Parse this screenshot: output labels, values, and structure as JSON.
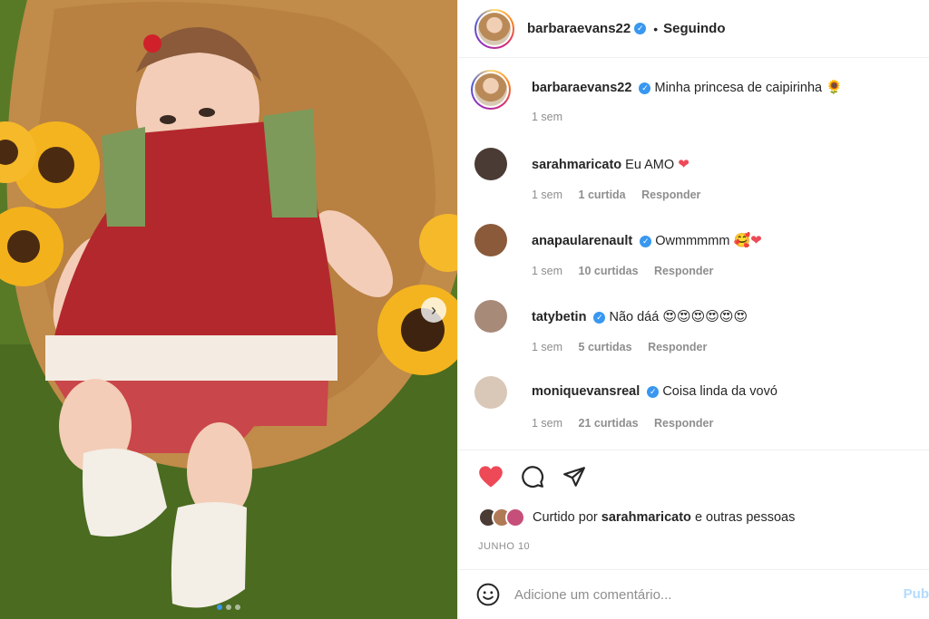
{
  "post": {
    "username": "barbaraevans22",
    "verified_mark": "✓",
    "separator": "•",
    "follow_label": "Seguindo"
  },
  "caption": {
    "username": "barbaraevans22",
    "text": "Minha princesa de caipirinha",
    "emoji": "🌻",
    "time": "1 sem"
  },
  "comments": [
    {
      "username": "sarahmaricato",
      "verified": false,
      "text": "Eu AMO",
      "emoji": "❤",
      "time": "1 sem",
      "likes": "1 curtida",
      "reply": "Responder",
      "avatar_color": "#4a3b34"
    },
    {
      "username": "anapaularenault",
      "verified": true,
      "text": "Owmmmmm",
      "emoji": "🥰❤",
      "time": "1 sem",
      "likes": "10 curtidas",
      "reply": "Responder",
      "avatar_color": "#8a5a3a"
    },
    {
      "username": "tatybetin",
      "verified": true,
      "text": "Não dáá",
      "emoji": "😍😍😍😍😍😍",
      "time": "1 sem",
      "likes": "5 curtidas",
      "reply": "Responder",
      "avatar_color": "#a88a79"
    },
    {
      "username": "moniquevansreal",
      "verified": true,
      "text": "Coisa linda da vovó",
      "emoji": "",
      "time": "1 sem",
      "likes": "21 curtidas",
      "reply": "Responder",
      "avatar_color": "#d9c7b8"
    }
  ],
  "icons": {
    "like": "heart-filled-icon",
    "comment": "comment-bubble-icon",
    "share": "paper-plane-icon",
    "emoji": "smiley-icon",
    "next": "chevron-right-icon"
  },
  "likes": {
    "prefix": "Curtido por",
    "user": "sarahmaricato",
    "suffix": "e outras pessoas"
  },
  "date": "JUNHO 10",
  "add_comment": {
    "placeholder": "Adicione um comentário...",
    "publish_label": "Pub"
  },
  "colors": {
    "like_red": "#ed4956",
    "verified_blue": "#3897f0",
    "muted_text": "#8e8e8e",
    "publish_disabled": "#b3dbff"
  }
}
